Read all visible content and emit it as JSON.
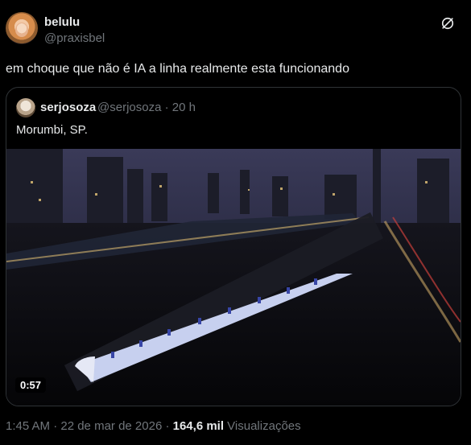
{
  "author": {
    "display_name": "belulu",
    "handle": "@praxisbel",
    "avatar_icon": "user-avatar"
  },
  "tweet": {
    "text": "em choque que não é IA a linha realmente esta funcionando"
  },
  "quoted_tweet": {
    "display_name": "serjosoza",
    "meta": "@serjosoza · 20 h",
    "text": "Morumbi, SP.",
    "video_duration": "0:57"
  },
  "footer": {
    "timestamp": "1:45 AM · 22 de mar de 2026 · ",
    "views_count": "164,6 mil",
    "views_label": " Visualizações"
  },
  "icons": {
    "grok": "grok-icon"
  },
  "colors": {
    "background": "#000000",
    "text_primary": "#e7e9ea",
    "text_secondary": "#71767b",
    "border": "#2f3336"
  }
}
